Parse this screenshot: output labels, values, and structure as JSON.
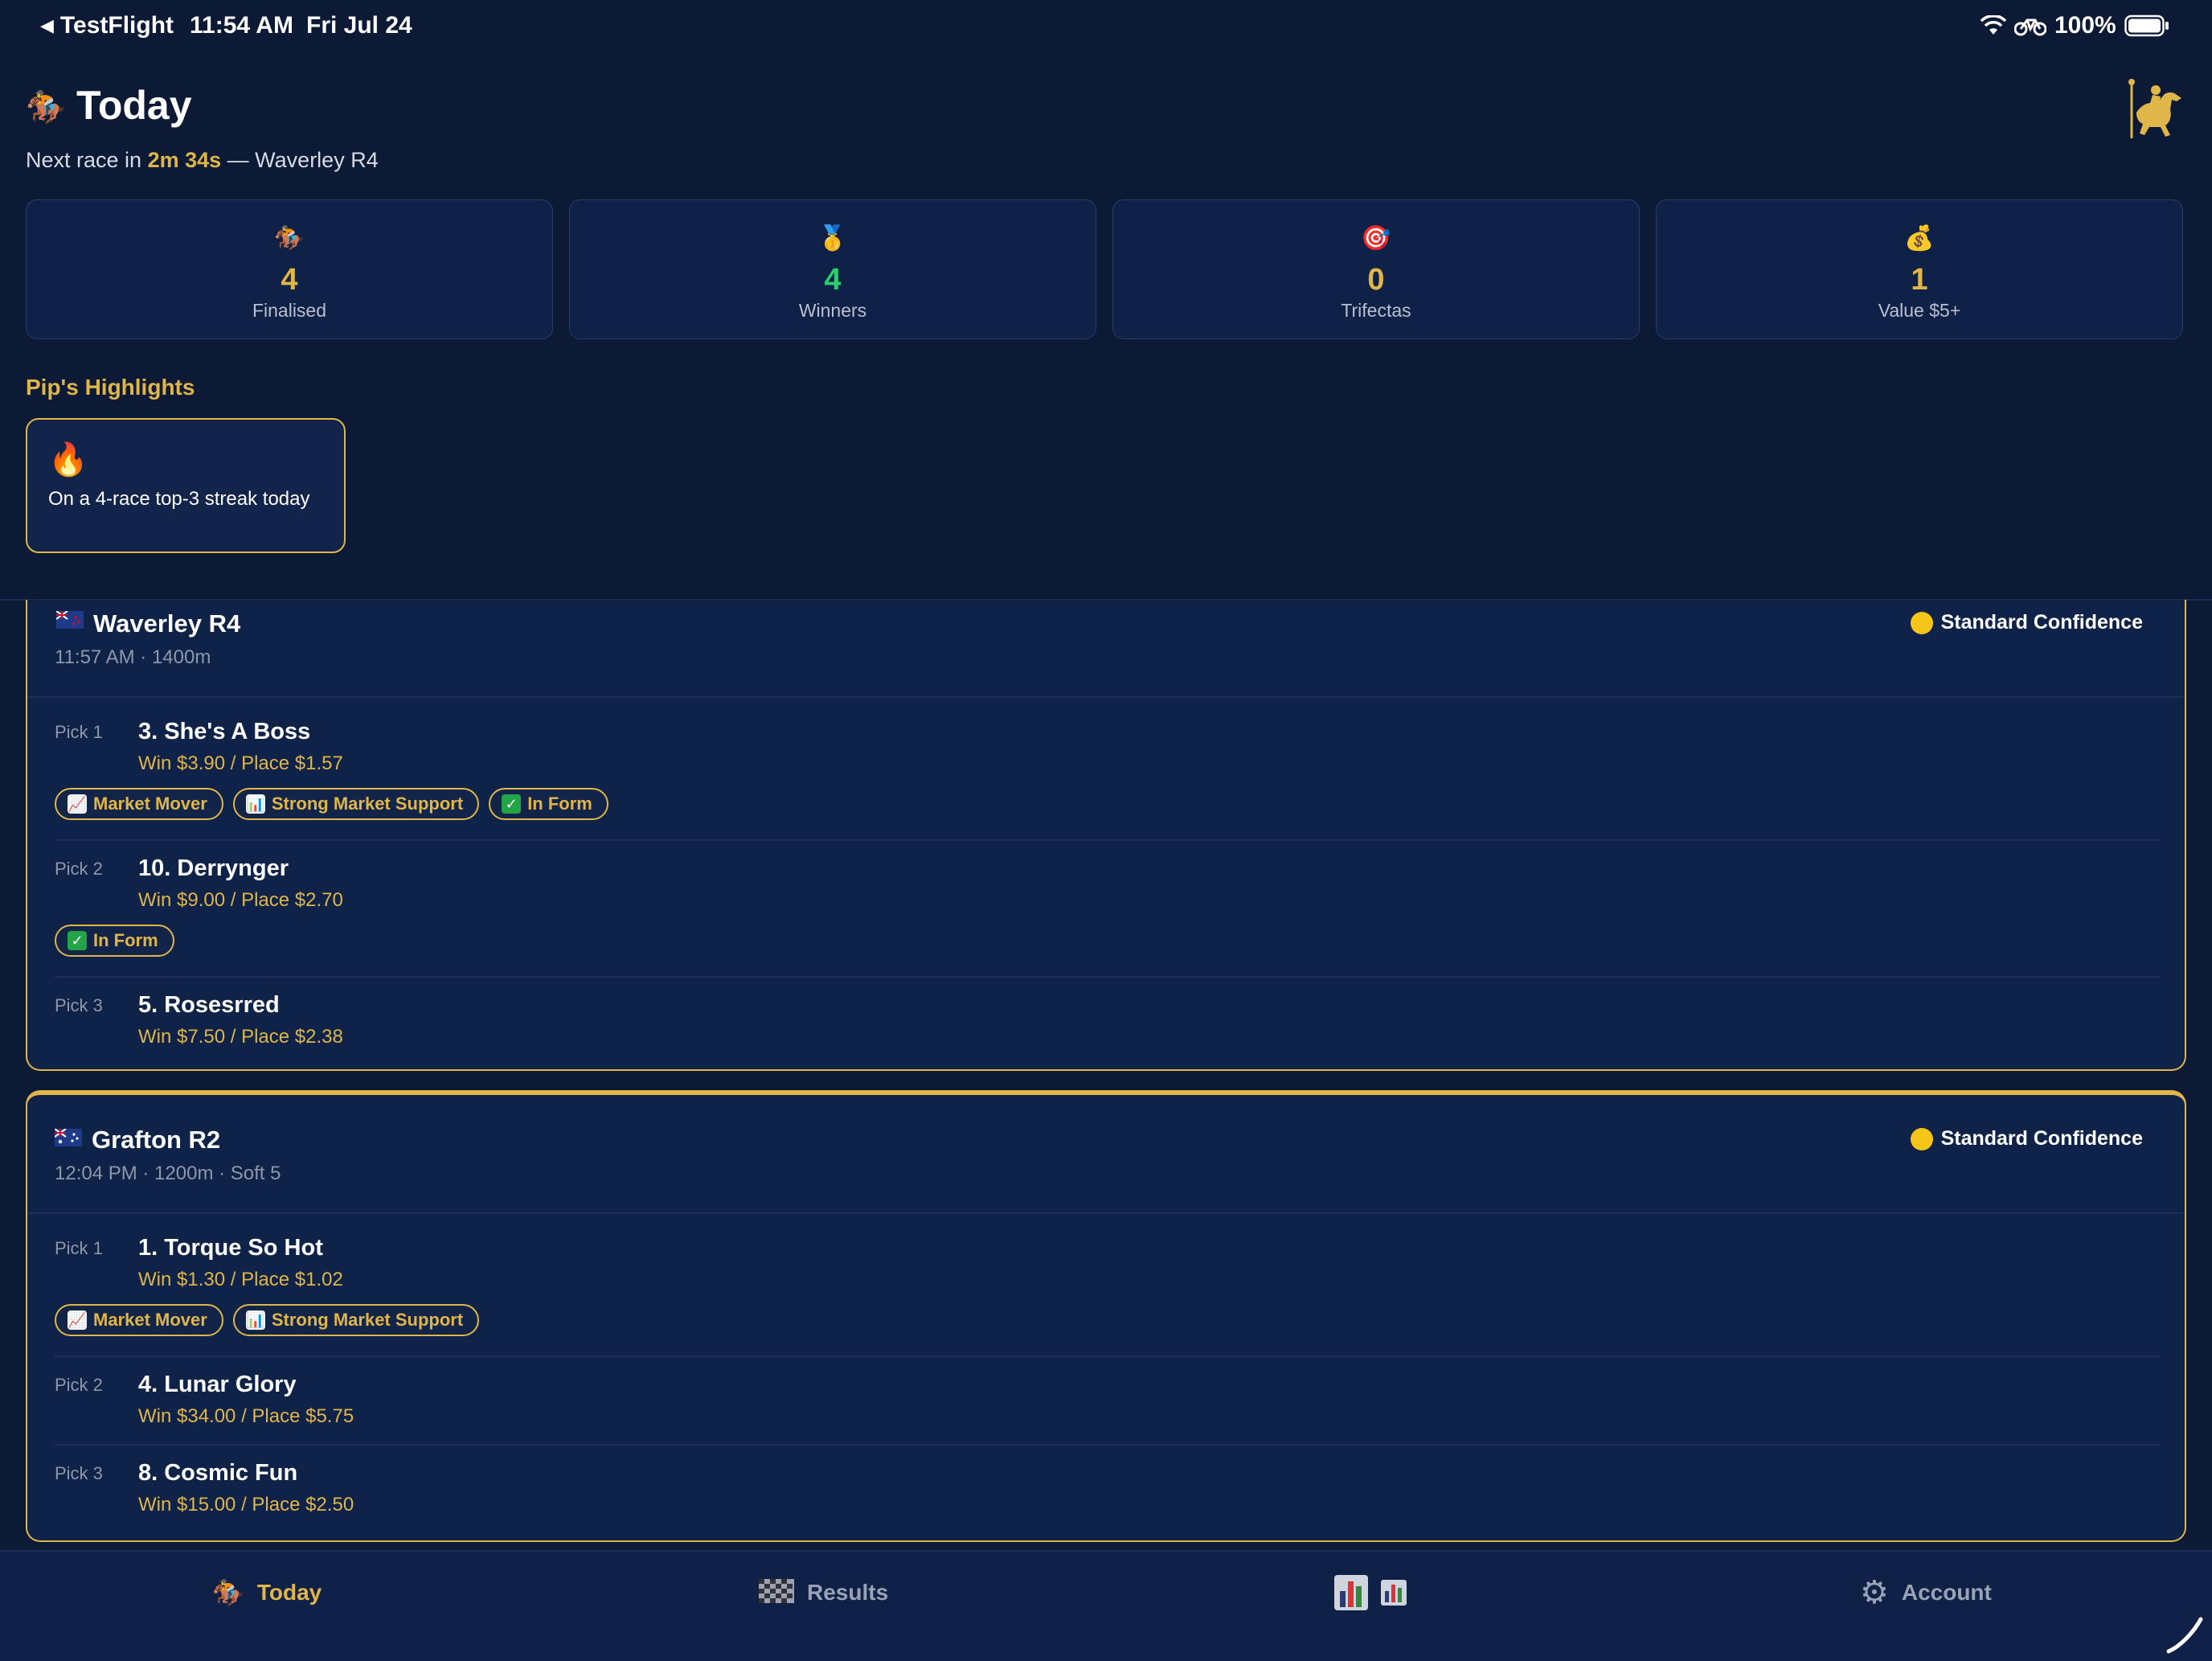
{
  "status_bar": {
    "back_app": "TestFlight",
    "time": "11:54 AM",
    "date": "Fri Jul 24",
    "battery": "100%"
  },
  "header": {
    "title": "Today",
    "title_icon": "horse-racing-icon",
    "next_race_prefix": "Next race in",
    "next_race_countdown": "2m 34s",
    "next_race_suffix": "— Waverley R4",
    "logo_icon": "horse-rider-logo-icon"
  },
  "stats": [
    {
      "icon": "horse-racing-icon",
      "value": "4",
      "label": "Finalised",
      "color": "#e0b54a"
    },
    {
      "icon": "medal-icon",
      "value": "4",
      "label": "Winners",
      "color": "#2ecc71"
    },
    {
      "icon": "target-icon",
      "value": "0",
      "label": "Trifectas",
      "color": "#e0b54a"
    },
    {
      "icon": "money-bag-icon",
      "value": "1",
      "label": "Value $5+",
      "color": "#e0b54a"
    }
  ],
  "highlights": {
    "heading": "Pip's Highlights",
    "items": [
      {
        "icon": "fire-icon",
        "text": "On a 4-race top-3 streak today"
      }
    ]
  },
  "races": [
    {
      "name": "Waverley R4",
      "flag": "nz-flag-icon",
      "meta": "11:57 AM · 1400m",
      "confidence": "Standard Confidence",
      "picks": [
        {
          "label": "Pick 1",
          "horse": "3. She's A Boss",
          "odds": "Win $3.90 / Place $1.57",
          "tags": [
            "Market Mover",
            "Strong Market Support",
            "In Form"
          ]
        },
        {
          "label": "Pick 2",
          "horse": "10. Derrynger",
          "odds": "Win $9.00 / Place $2.70",
          "tags": [
            "In Form"
          ]
        },
        {
          "label": "Pick 3",
          "horse": "5. Rosesrred",
          "odds": "Win $7.50 / Place $2.38",
          "tags": []
        }
      ]
    },
    {
      "name": "Grafton R2",
      "flag": "au-flag-icon",
      "meta": "12:04 PM · 1200m · Soft 5",
      "confidence": "Standard Confidence",
      "picks": [
        {
          "label": "Pick 1",
          "horse": "1. Torque So Hot",
          "odds": "Win $1.30 / Place $1.02",
          "tags": [
            "Market Mover",
            "Strong Market Support"
          ]
        },
        {
          "label": "Pick 2",
          "horse": "4. Lunar Glory",
          "odds": "Win $34.00 / Place $5.75",
          "tags": []
        },
        {
          "label": "Pick 3",
          "horse": "8. Cosmic Fun",
          "odds": "Win $15.00 / Place $2.50",
          "tags": []
        }
      ]
    }
  ],
  "tabbar": {
    "today": "Today",
    "results": "Results",
    "stats": "",
    "account": "Account"
  },
  "colors": {
    "background": "#0c1a36",
    "card": "#0f2247",
    "accent_gold": "#e0b54a",
    "win_green": "#2ecc71"
  }
}
